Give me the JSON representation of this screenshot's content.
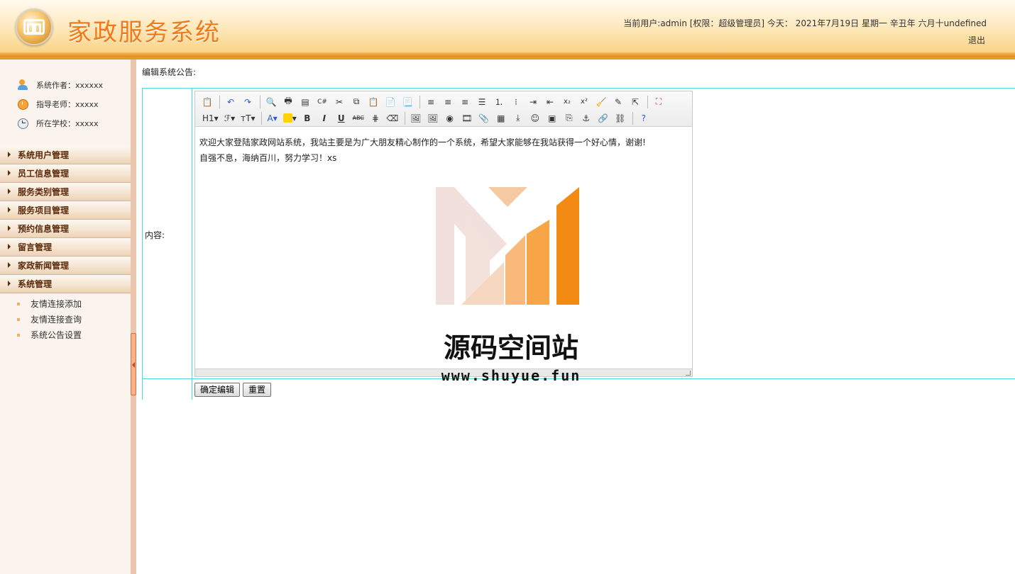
{
  "header": {
    "app_title": "家政服务系统",
    "user_info": "当前用户:admin [权限：超级管理员] 今天： 2021年7月19日 星期一 辛丑年 六月十undefined",
    "logout_label": "退出"
  },
  "sidebar": {
    "meta": [
      {
        "icon": "users-icon",
        "text": "系统作者：xxxxxx"
      },
      {
        "icon": "alarm-clock-icon",
        "text": "指导老师：xxxxx"
      },
      {
        "icon": "clock-icon",
        "text": "所在学校：xxxxx"
      }
    ],
    "menu": [
      {
        "label": "系统用户管理"
      },
      {
        "label": "员工信息管理"
      },
      {
        "label": "服务类别管理"
      },
      {
        "label": "服务项目管理"
      },
      {
        "label": "预约信息管理"
      },
      {
        "label": "留言管理"
      },
      {
        "label": "家政新闻管理"
      },
      {
        "label": "系统管理",
        "submenu": [
          "友情连接添加",
          "友情连接查询",
          "系统公告设置"
        ]
      }
    ]
  },
  "main": {
    "page_caption": "编辑系统公告:",
    "content_label": "内容:",
    "editor": {
      "toolbar_row2_labels": {
        "heading": "H1",
        "font": "ℱ",
        "size": "ᴛT",
        "bold": "B",
        "italic": "I",
        "underline": "U",
        "strike": "ABC"
      },
      "content_lines": [
        "欢迎大家登陆家政网站系统，我站主要是为广大朋友精心制作的一个系统，希望大家能够在我站获得一个好心情，谢谢!",
        "自强不息，海纳百川，努力学习！xs"
      ]
    },
    "submit_label": "确定编辑",
    "reset_label": "重置"
  },
  "watermark": {
    "title": "源码空间站",
    "url": "www.shuyue.fun"
  },
  "colors": {
    "brand_orange": "#f07a1a",
    "table_border": "#4ed8d8",
    "menu_text": "#5a2a0a"
  }
}
